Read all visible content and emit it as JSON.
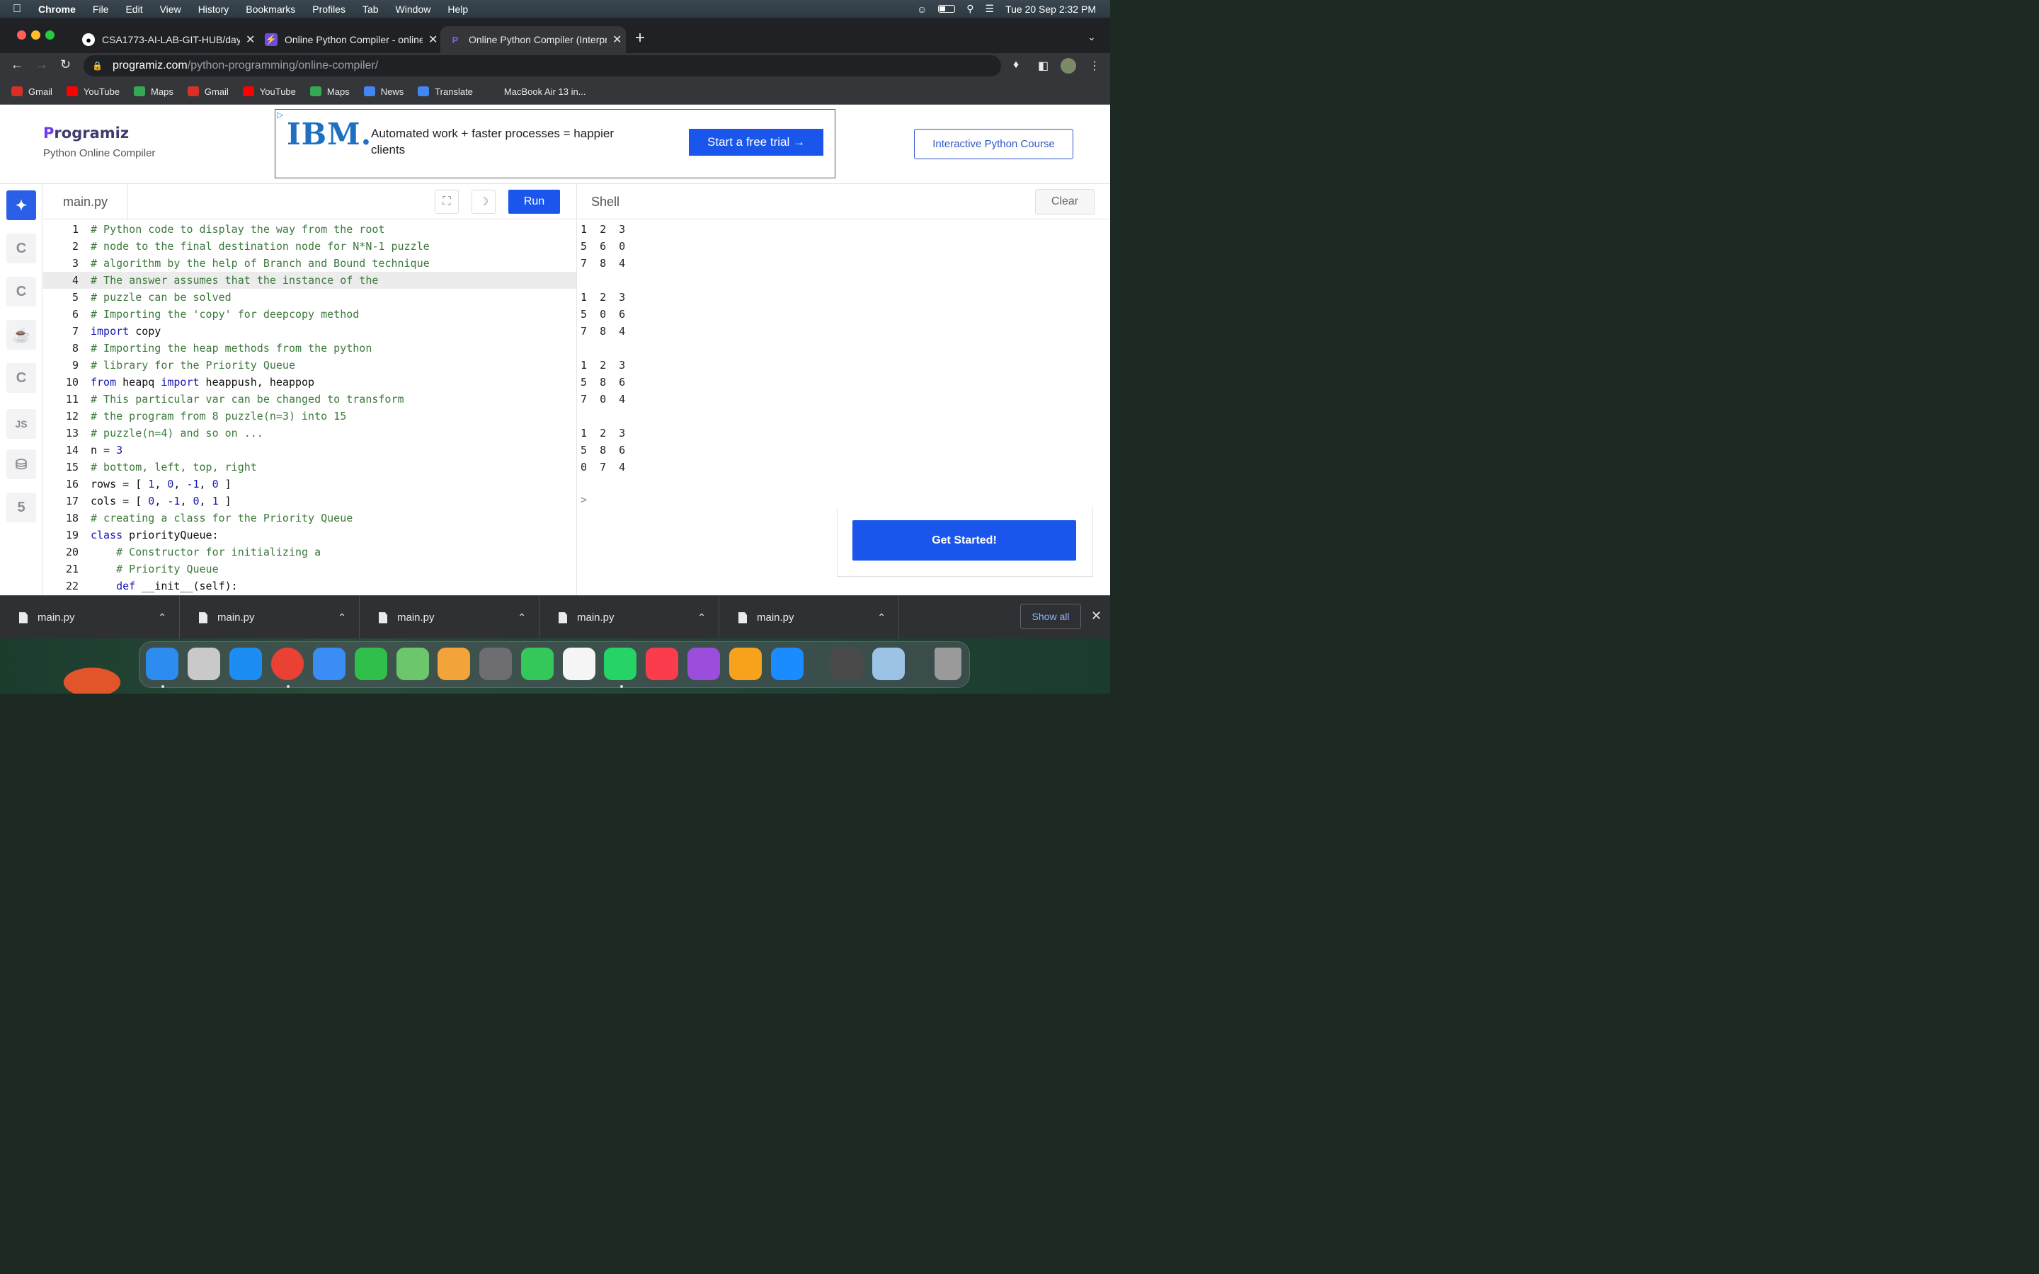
{
  "menubar": {
    "app": "Chrome",
    "items": [
      "File",
      "Edit",
      "View",
      "History",
      "Bookmarks",
      "Profiles",
      "Tab",
      "Window",
      "Help"
    ],
    "datetime": "Tue 20 Sep  2:32 PM"
  },
  "browser": {
    "tabs": [
      {
        "title": "CSA1773-AI-LAB-GIT-HUB/day",
        "icon": "github-icon"
      },
      {
        "title": "Online Python Compiler - online",
        "icon": "bolt-icon"
      },
      {
        "title": "Online Python Compiler (Interpreter)",
        "icon": "programiz-icon"
      }
    ],
    "url_host": "programiz.com",
    "url_path": "/python-programming/online-compiler/",
    "bookmarks": [
      {
        "label": "Gmail",
        "color": "#d93025"
      },
      {
        "label": "YouTube",
        "color": "#ff0000"
      },
      {
        "label": "Maps",
        "color": "#34a853"
      },
      {
        "label": "Gmail",
        "color": "#d93025"
      },
      {
        "label": "YouTube",
        "color": "#ff0000"
      },
      {
        "label": "Maps",
        "color": "#34a853"
      },
      {
        "label": "News",
        "color": "#4285f4"
      },
      {
        "label": "Translate",
        "color": "#4285f4"
      },
      {
        "label": "MacBook Air 13 in...",
        "color": ""
      }
    ]
  },
  "page": {
    "brand_logo_rest": "rogramiz",
    "brand_logo_p": "P",
    "brand_subtitle": "Python Online Compiler",
    "ad": {
      "logo": "IBM.",
      "text": "Automated work + faster processes = happier clients",
      "cta": "Start a free trial →"
    },
    "course_button": "Interactive Python Course",
    "editor": {
      "filename": "main.py",
      "run_label": "Run"
    },
    "shell": {
      "title": "Shell",
      "clear_label": "Clear",
      "prompt": ">",
      "output": [
        "1  2  3",
        "5  6  0",
        "7  8  4",
        "",
        "1  2  3",
        "5  0  6",
        "7  8  4",
        "",
        "1  2  3",
        "5  8  6",
        "7  0  4",
        "",
        "1  2  3",
        "5  8  6",
        "0  7  4"
      ]
    },
    "get_started": "Get Started!",
    "sidebar_icons": [
      "python-icon",
      "c-icon",
      "cpp-icon",
      "java-icon",
      "csharp-icon",
      "js-icon",
      "sql-icon",
      "html5-icon"
    ],
    "sidebar_js_label": "JS"
  },
  "code_lines": [
    "# Python code to display the way from the root",
    "# node to the final destination node for N*N-1 puzzle",
    "# algorithm by the help of Branch and Bound technique",
    "# The answer assumes that the instance of the",
    "# puzzle can be solved",
    "# Importing the 'copy' for deepcopy method",
    "import copy",
    "# Importing the heap methods from the python",
    "# library for the Priority Queue",
    "from heapq import heappush, heappop",
    "# This particular var can be changed to transform",
    "# the program from 8 puzzle(n=3) into 15",
    "# puzzle(n=4) and so on ...",
    "n = 3",
    "# bottom, left, top, right",
    "rows = [ 1, 0, -1, 0 ]",
    "cols = [ 0, -1, 0, 1 ]",
    "# creating a class for the Priority Queue",
    "class priorityQueue:",
    "    # Constructor for initializing a",
    "    # Priority Queue",
    "    def __init__(self):"
  ],
  "downloads": {
    "items": [
      "main.py",
      "main.py",
      "main.py",
      "main.py",
      "main.py"
    ],
    "show_all": "Show all"
  }
}
